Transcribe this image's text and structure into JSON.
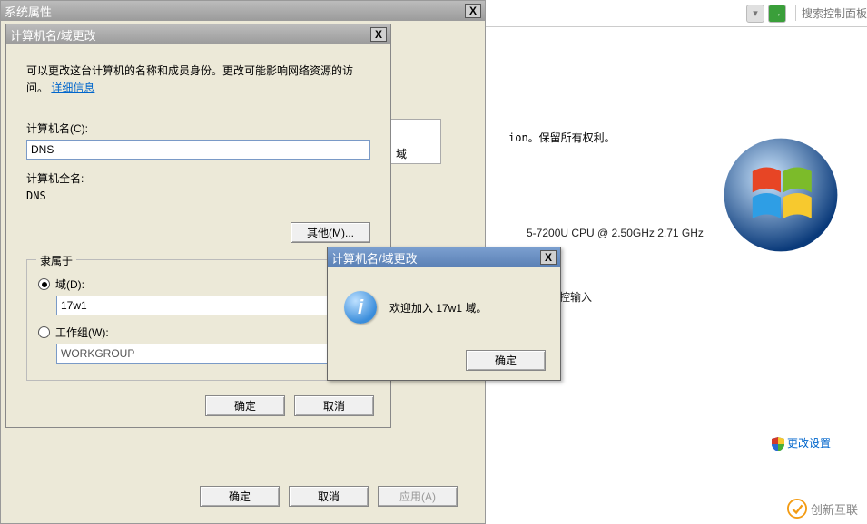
{
  "breadcrumb": {
    "search_placeholder": "搜索控制面板",
    "back_glyph": "▾",
    "forward_glyph": "→"
  },
  "right_panel": {
    "rights_tail": "ion。保留所有权利。",
    "cpu_line": "5-7200U CPU @ 2.50GHz   2.71 GHz",
    "pen_line": "笔或触控输入",
    "change_settings": "更改设置"
  },
  "watermark": {
    "text": "创新互联"
  },
  "sysprop": {
    "title": "系统属性",
    "partial_label": "域",
    "buttons": {
      "ok": "确定",
      "cancel": "取消",
      "apply": "应用(A)"
    }
  },
  "rename": {
    "title": "计算机名/域更改",
    "desc_pre": "可以更改这台计算机的名称和成员身份。更改可能影响网络资源的访问。",
    "desc_link": "详细信息",
    "computer_name_label": "计算机名(C):",
    "computer_name_value": "DNS",
    "full_name_label": "计算机全名:",
    "full_name_value": "DNS",
    "other_btn": "其他(M)...",
    "member_of": "隶属于",
    "domain_label": "域(D):",
    "domain_value": "17w1",
    "workgroup_label": "工作组(W):",
    "workgroup_value": "WORKGROUP",
    "buttons": {
      "ok": "确定",
      "cancel": "取消"
    }
  },
  "msgbox": {
    "title": "计算机名/域更改",
    "text": "欢迎加入 17w1 域。",
    "ok": "确定"
  },
  "icon_glyphs": {
    "close": "X",
    "info": "i"
  }
}
